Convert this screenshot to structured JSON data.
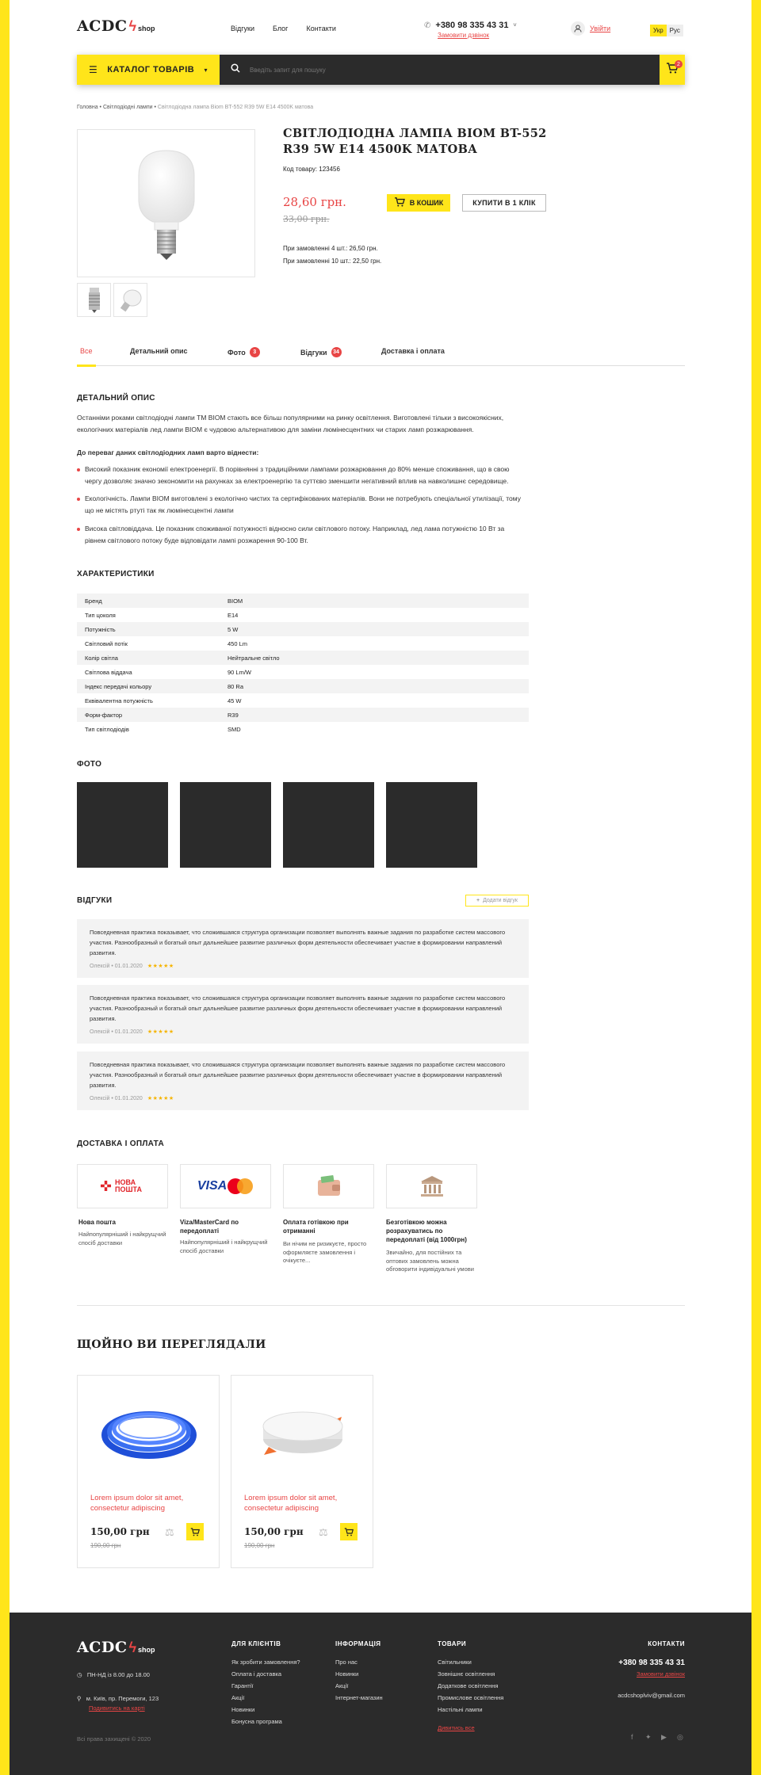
{
  "header": {
    "logo_main": "ACDC",
    "logo_sub": "shop",
    "nav": [
      "Відгуки",
      "Блог",
      "Контакти"
    ],
    "phone": "+380 98 335 43 31",
    "callback": "Замовити дзвінок",
    "login": "Увійти",
    "lang": [
      "Укр",
      "Рус"
    ]
  },
  "searchbar": {
    "catalog_label": "КАТАЛОГ ТОВАРІВ",
    "placeholder": "Введіть запит для пошуку",
    "cart_count": "2"
  },
  "breadcrumb": {
    "items": [
      "Головна",
      "Світлодіодні лампи"
    ],
    "current": "Світлодіодна лампа Biom BT-552 R39 5W E14 4500K матова"
  },
  "product": {
    "title": "СВІТЛОДІОДНА ЛАМПА BIOM BT-552 R39 5W E14 4500K МАТОВА",
    "code": "Код товару: 123456",
    "price": "28,60 грн.",
    "old_price": "33,00 грн.",
    "btn_cart": "В КОШИК",
    "btn_one_click": "КУПИТИ В 1 КЛІК",
    "bulk": [
      "При замовленні 4 шт.: 26,50 грн.",
      "При замовленні 10 шт.: 22,50 грн."
    ]
  },
  "tabs": [
    {
      "label": "Все",
      "count": ""
    },
    {
      "label": "Детальний опис",
      "count": ""
    },
    {
      "label": "Фото",
      "count": "3"
    },
    {
      "label": "Відгуки",
      "count": "34"
    },
    {
      "label": "Доставка і оплата",
      "count": ""
    }
  ],
  "description": {
    "heading": "ДЕТАЛЬНИЙ ОПИС",
    "intro": "Останніми роками світлодіодні лампи ТМ BIOM стають все більш популярними на ринку освітлення. Виготовлені тільки з високоякісних, екологічних матеріалів лед лампи BIOM є чудовою альтернативою для заміни люмінесцентних чи старих ламп розжарювання.",
    "adv_heading": "До переваг даних світлодіодних ламп варто віднести:",
    "bullets": [
      "Високий показник економії електроенергії. В порівнянні з традиційними лампами розжарювання до 80% менше споживання, що в свою чергу дозволяє значно зекономити на рахунках за електроенергію та суттєво зменшити негативний вплив на навколишнє середовище.",
      "Екологічність. Лампи BIOM виготовлені з екологічно чистих та сертифікованих матеріалів. Вони не потребують спеціальної утилізації, тому що не містять ртуті так як люмінесцентні лампи",
      "Висока світловіддача. Це показник споживаної потужності відносно сили світлового потоку. Наприклад, лед лама потужністю 10 Вт за рівнем світлового потоку буде відповідати лампі розжарення 90-100 Вт."
    ]
  },
  "specs": {
    "heading": "ХАРАКТЕРИСТИКИ",
    "rows": [
      [
        "Бренд",
        "BIOM"
      ],
      [
        "Тип цоколя",
        "E14"
      ],
      [
        "Потужність",
        "5 W"
      ],
      [
        "Світловий потік",
        "450 Lm"
      ],
      [
        "Колір світла",
        "Нейтральне світло"
      ],
      [
        "Світлова віддача",
        "90 Lm/W"
      ],
      [
        "Індекс передачі кольору",
        "80 Ra"
      ],
      [
        "Еквівалентна потужність",
        "45 W"
      ],
      [
        "Форм-фактор",
        "R39"
      ],
      [
        "Тип світлодіодів",
        "SMD"
      ]
    ]
  },
  "photos": {
    "heading": "ФОТО"
  },
  "reviews": {
    "heading": "ВІДГУКИ",
    "add_btn": "Додати відгук",
    "items": [
      {
        "text": "Повседневная практика показывает, что сложившаяся структура организации позволяет выполнять важные задания по разработке систем массового участия. Разнообразный и богатый опыт дальнейшее развитие различных форм деятельности обеспечивает участие в формировании направлений развития.",
        "author": "Олексій • 01.01.2020",
        "stars": "★★★★★"
      },
      {
        "text": "Повседневная практика показывает, что сложившаяся структура организации позволяет выполнять важные задания по разработке систем массового участия. Разнообразный и богатый опыт дальнейшее развитие различных форм деятельности обеспечивает участие в формировании направлений развития.",
        "author": "Олексій • 01.01.2020",
        "stars": "★★★★★"
      },
      {
        "text": "Повседневная практика показывает, что сложившаяся структура организации позволяет выполнять важные задания по разработке систем массового участия. Разнообразный и богатый опыт дальнейшее развитие различных форм деятельности обеспечивает участие в формировании направлений развития.",
        "author": "Олексій • 01.01.2020",
        "stars": "★★★★★"
      }
    ]
  },
  "delivery": {
    "heading": "ДОСТАВКА І ОПЛАТА",
    "np_logo": "НОВА ПОШТА",
    "visa_logo": "VISA",
    "items": [
      {
        "title": "Нова пошта",
        "desc": "Найпопулярніший і найкрущчий спосіб доставки"
      },
      {
        "title": "Viza/MasterCard по передоплаті",
        "desc": "Найпопулярніший і найкрущчий спосіб доставки"
      },
      {
        "title": "Оплата готівкою при отриманні",
        "desc": "Ви нічим не ризикуєте, просто оформляєте замовлення і очікуєте..."
      },
      {
        "title": "Безготівкою можна розрахуватись по передоплаті (від 1000грн)",
        "desc": "Звичайно, для постійних та оптових замовлень можна обговорити індивідуальні умови"
      }
    ]
  },
  "recent": {
    "heading": "ЩОЙНО ВИ ПЕРЕГЛЯДАЛИ",
    "items": [
      {
        "name": "Lorem ipsum dolor sit amet, consectetur adipiscing",
        "price": "150,00 грн",
        "old": "190,00 грн"
      },
      {
        "name": "Lorem ipsum dolor sit amet, consectetur adipiscing",
        "price": "150,00 грн",
        "old": "190,00 грн"
      }
    ]
  },
  "footer": {
    "logo_main": "ACDC",
    "logo_sub": "shop",
    "hours": "ПН-НД із 8.00 до 18.00",
    "address": "м. Київ, пр. Перемоги, 123",
    "map_link": "Подивитись на карті",
    "copyright": "Всі права захищені © 2020",
    "clients_h": "ДЛЯ КЛІЄНТІВ",
    "clients": [
      "Як зробити замовлення?",
      "Оплата і доставка",
      "Гарантії",
      "Акції",
      "Новинки",
      "Бонусна програма"
    ],
    "info_h": "ІНФОРМАЦІЯ",
    "info": [
      "Про нас",
      "Новинки",
      "Акції",
      "Інтернет-магазин"
    ],
    "goods_h": "ТОВАРИ",
    "goods": [
      "Світильники",
      "Зовнішнє освітлення",
      "Додаткове освітлення",
      "Промислове освітлення",
      "Настільні лампи"
    ],
    "goods_all": "Дивитись все",
    "contacts_h": "КОНТАКТИ",
    "phone": "+380 98 335 43 31",
    "callback": "Замовити дзвінок",
    "email": "acdcshoplviv@gmail.com"
  }
}
